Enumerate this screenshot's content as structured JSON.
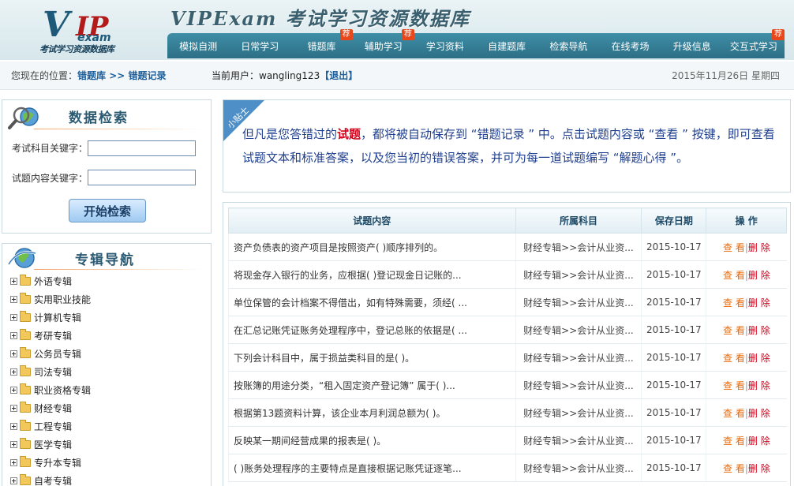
{
  "header": {
    "logo": {
      "v": "V",
      "ip": "IP",
      "exam": "exam",
      "tagline": "考试学习资源数据库"
    },
    "banner_title": "VIPExam 考试学习资源数据库",
    "nav": [
      {
        "label": "模拟自测",
        "hot": ""
      },
      {
        "label": "日常学习",
        "hot": ""
      },
      {
        "label": "错题库",
        "hot": "荐"
      },
      {
        "label": "辅助学习",
        "hot": "荐"
      },
      {
        "label": "学习资料",
        "hot": ""
      },
      {
        "label": "自建题库",
        "hot": ""
      },
      {
        "label": "检索导航",
        "hot": ""
      },
      {
        "label": "在线考场",
        "hot": ""
      },
      {
        "label": "升级信息",
        "hot": ""
      },
      {
        "label": "交互式学习",
        "hot": "荐"
      }
    ]
  },
  "locbar": {
    "prefix": "您现在的位置：",
    "crumb1": "错题库",
    "crumb_sep": " >> ",
    "crumb2": "错题记录",
    "user_prefix": "当前用户：",
    "username": "wangling123",
    "logout": "【退出】",
    "date": "2015年11月26日  星期四"
  },
  "search": {
    "title": "数据检索",
    "field1_label": "考试科目关键字：",
    "field1_value": "",
    "field2_label": "试题内容关键字：",
    "field2_value": "",
    "button": "开始检索"
  },
  "album_nav": {
    "title": "专辑导航",
    "items": [
      "外语专辑",
      "实用职业技能",
      "计算机专辑",
      "考研专辑",
      "公务员专辑",
      "司法专辑",
      "职业资格专辑",
      "财经专辑",
      "工程专辑",
      "医学专辑",
      "专升本专辑",
      "自考专辑"
    ]
  },
  "tip": {
    "badge": "小贴士",
    "t1": "但凡是您答错过的",
    "t2": "试题",
    "t3": "，都将被自动保存到 “错题记录 ” 中。点击试题内容或 “查看 ” 按键，即可查看试题文本和标准答案，以及您当初的错误答案，并可为每一道试题编写 “解题心得 ”。"
  },
  "table": {
    "headers": [
      "试题内容",
      "所属科目",
      "保存日期",
      "操  作"
    ],
    "rows": [
      {
        "question": "资产负债表的资产项目是按照资产( )顺序排列的。",
        "subject": "财经专辑>>会计从业资...",
        "date": "2015-10-17"
      },
      {
        "question": "将现金存入银行的业务，应根据( )登记现金日记账的...",
        "subject": "财经专辑>>会计从业资...",
        "date": "2015-10-17"
      },
      {
        "question": "单位保管的会计档案不得借出，如有特殊需要，须经( ...",
        "subject": "财经专辑>>会计从业资...",
        "date": "2015-10-17"
      },
      {
        "question": "在汇总记账凭证账务处理程序中，登记总账的依据是( ...",
        "subject": "财经专辑>>会计从业资...",
        "date": "2015-10-17"
      },
      {
        "question": "下列会计科目中，属于损益类科目的是( )。",
        "subject": "财经专辑>>会计从业资...",
        "date": "2015-10-17"
      },
      {
        "question": "按账簿的用途分类，“租入固定资产登记簿” 属于( )...",
        "subject": "财经专辑>>会计从业资...",
        "date": "2015-10-17"
      },
      {
        "question": "根据第13题资料计算，该企业本月利润总额为( )。",
        "subject": "财经专辑>>会计从业资...",
        "date": "2015-10-17"
      },
      {
        "question": "反映某一期间经营成果的报表是( )。",
        "subject": "财经专辑>>会计从业资...",
        "date": "2015-10-17"
      },
      {
        "question": "( )账务处理程序的主要特点是直接根据记账凭证逐笔...",
        "subject": "财经专辑>>会计从业资...",
        "date": "2015-10-17"
      }
    ],
    "op_view": "查 看",
    "op_sep": "|",
    "op_delete": "删 除"
  }
}
